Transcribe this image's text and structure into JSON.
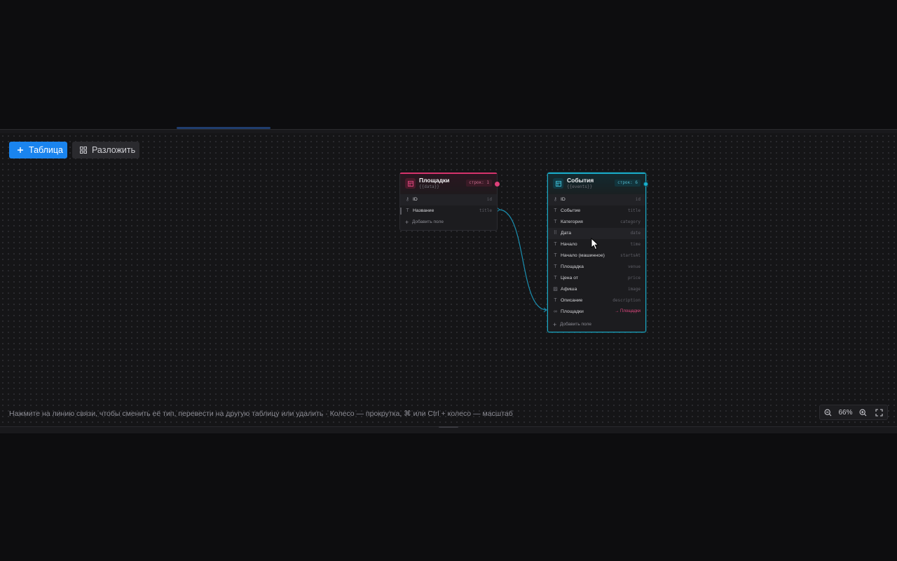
{
  "toolbar": {
    "add_table_label": "Таблица",
    "layout_label": "Разложить"
  },
  "tables": [
    {
      "title": "Площадки",
      "source": "{{data}}",
      "rows_badge": "строк: 1",
      "accent": "#d6336c",
      "fields": [
        {
          "icon": "key-icon",
          "label": "ID",
          "key": "id"
        },
        {
          "icon": "text-type-icon",
          "label": "Название",
          "key": "title"
        }
      ],
      "add_field_label": "Добавить поле"
    },
    {
      "title": "События",
      "source": "{{events}}",
      "rows_badge": "строк: 6",
      "accent": "#1aa8c4",
      "fields": [
        {
          "icon": "key-icon",
          "label": "ID",
          "key": "id"
        },
        {
          "icon": "text-type-icon",
          "label": "Событие",
          "key": "title"
        },
        {
          "icon": "text-type-icon",
          "label": "Категория",
          "key": "category"
        },
        {
          "icon": "drag-handle-icon",
          "label": "Дата",
          "key": "date"
        },
        {
          "icon": "text-type-icon",
          "label": "Начало",
          "key": "time"
        },
        {
          "icon": "text-type-icon",
          "label": "Начало (машинное)",
          "key": "startsAt"
        },
        {
          "icon": "text-type-icon",
          "label": "Площадка",
          "key": "venue"
        },
        {
          "icon": "text-type-icon",
          "label": "Цена от",
          "key": "price"
        },
        {
          "icon": "image-icon",
          "label": "Афиша",
          "key": "image"
        },
        {
          "icon": "text-type-icon",
          "label": "Описание",
          "key": "description"
        },
        {
          "icon": "link-icon",
          "label": "Площадки",
          "key": "→ Площадки"
        }
      ],
      "add_field_label": "Добавить поле"
    }
  ],
  "hint": "Нажмите на линию связи, чтобы сменить её тип, перевести на другую таблицу или удалить · Колесо — прокрутка, ⌘ или Ctrl + колесо — масштаб",
  "zoom": {
    "value": "66%"
  },
  "colors": {
    "primary": "#1a84ee",
    "relation": "#1aa8c4",
    "pink": "#d6336c"
  }
}
